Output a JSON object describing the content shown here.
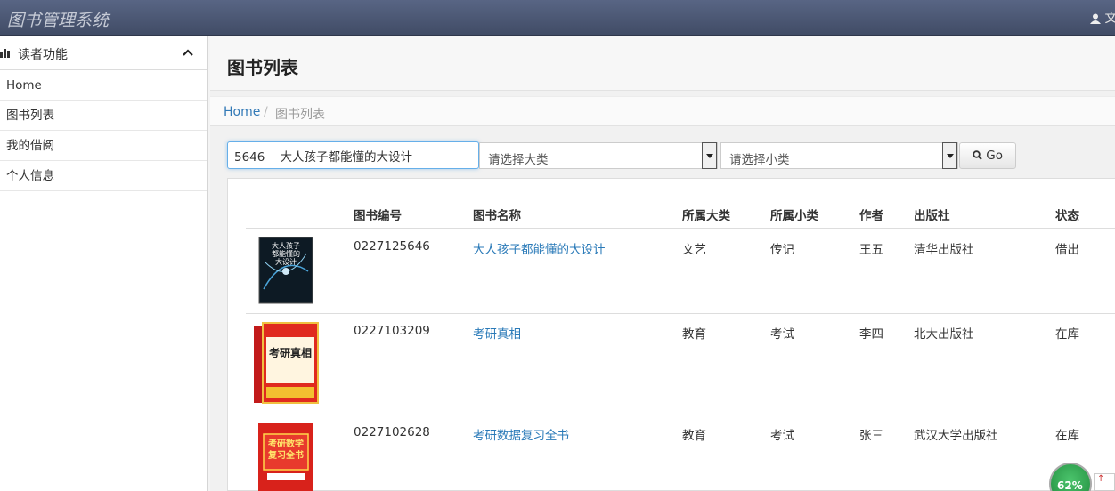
{
  "app": {
    "title": "图书管理系统",
    "user_fragment": "文"
  },
  "sidebar": {
    "header": "读者功能",
    "items": [
      {
        "label": "Home"
      },
      {
        "label": "图书列表"
      },
      {
        "label": "我的借阅"
      },
      {
        "label": "个人信息"
      }
    ]
  },
  "main": {
    "page_title": "图书列表",
    "breadcrumb": {
      "home": "Home",
      "separator": "/",
      "current": "图书列表"
    }
  },
  "search": {
    "query": "5646    大人孩子都能懂的大设计",
    "category_placeholder": "请选择大类",
    "subcategory_placeholder": "请选择小类",
    "go_label": "Go"
  },
  "table": {
    "headers": [
      "图书编号",
      "图书名称",
      "所属大类",
      "所属小类",
      "作者",
      "出版社",
      "状态"
    ],
    "rows": [
      {
        "id": "0227125646",
        "name": "大人孩子都能懂的大设计",
        "category": "文艺",
        "subcategory": "传记",
        "author": "王五",
        "publisher": "清华出版社",
        "status": "借出",
        "cover_text": "大人孩子都能懂的大设计"
      },
      {
        "id": "0227103209",
        "name": "考研真相",
        "category": "教育",
        "subcategory": "考试",
        "author": "李四",
        "publisher": "北大出版社",
        "status": "在库",
        "cover_text": "考研真相"
      },
      {
        "id": "0227102628",
        "name": "考研数据复习全书",
        "category": "教育",
        "subcategory": "考试",
        "author": "张三",
        "publisher": "武汉大学出版社",
        "status": "在库",
        "cover_text": "考研数学复习全书"
      }
    ]
  },
  "overlay": {
    "progress": "62%",
    "progress_value": 62,
    "accent": "#2a7ab8"
  }
}
